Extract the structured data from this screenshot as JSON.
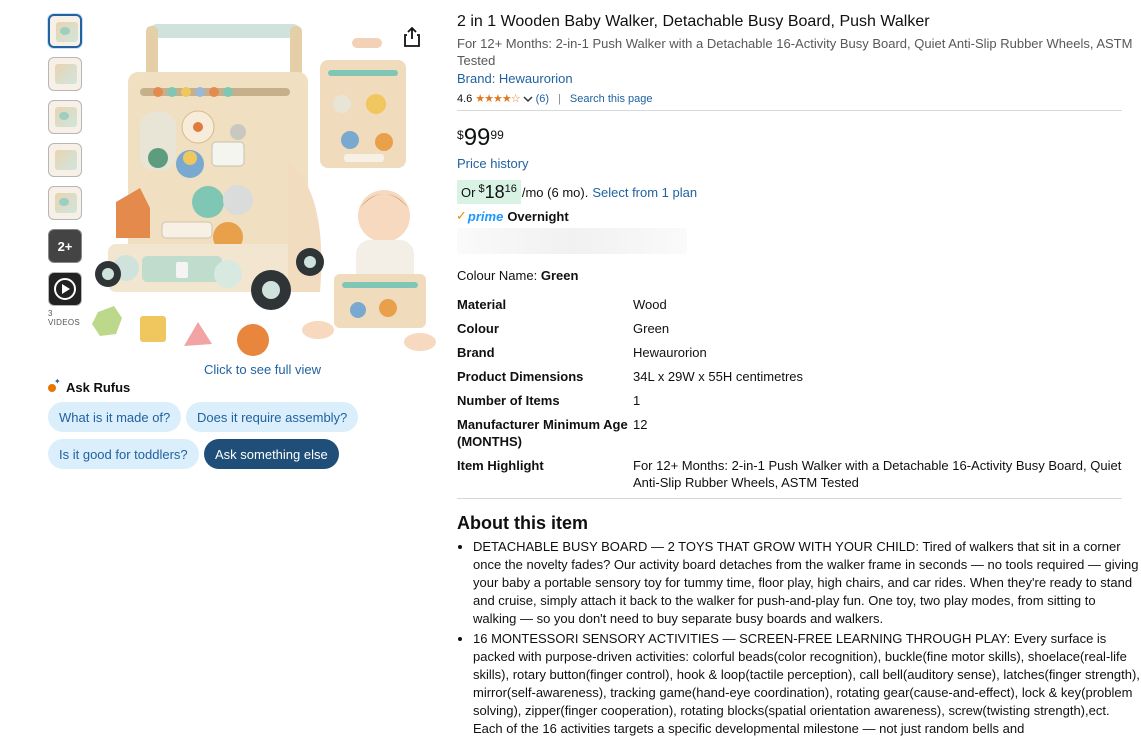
{
  "thumbnails": {
    "more_label": "2+",
    "videos_label": "3 VIDEOS"
  },
  "main_image": {
    "click_full_view": "Click to see full view"
  },
  "rufus": {
    "title": "Ask Rufus",
    "chips": [
      "What is it made of?",
      "Does it require assembly?",
      "Is it good for toddlers?",
      "Ask something else"
    ]
  },
  "product": {
    "title": "2 in 1 Wooden Baby Walker, Detachable Busy Board, Push Walker",
    "subtitle": "For 12+ Months: 2-in-1 Push Walker with a Detachable 16-Activity Busy Board, Quiet Anti-Slip Rubber Wheels, ASTM Tested",
    "brand_link": "Brand: Hewaurorion",
    "rating_value": "4.6",
    "rating_stars": "★★★★☆",
    "rating_count": "(6)",
    "rating_sep": "|",
    "search_page": "Search this page",
    "price_symbol": "$",
    "price_whole": "99",
    "price_fraction": "99",
    "price_history": "Price history",
    "plan_prefix": "Or",
    "plan_symbol": "$",
    "plan_whole": "18",
    "plan_fraction": "16",
    "plan_suffix": "/mo (6 mo).",
    "plan_link": "Select from 1 plan",
    "prime_check": "✓",
    "prime_word": "prime",
    "prime_delivery": "Overnight",
    "colour_label": "Colour Name:",
    "colour_value": "Green"
  },
  "specs": [
    {
      "k": "Material",
      "v": "Wood"
    },
    {
      "k": "Colour",
      "v": "Green"
    },
    {
      "k": "Brand",
      "v": "Hewaurorion"
    },
    {
      "k": "Product Dimensions",
      "v": "34L x 29W x 55H centimetres"
    },
    {
      "k": "Number of Items",
      "v": "1"
    },
    {
      "k": "Manufacturer Minimum Age (MONTHS)",
      "v": "12"
    },
    {
      "k": "Item Highlight",
      "v": "For 12+ Months: 2-in-1 Push Walker with a Detachable 16-Activity Busy Board, Quiet Anti-Slip Rubber Wheels, ASTM Tested"
    }
  ],
  "about": {
    "title": "About this item",
    "bullets": [
      "DETACHABLE BUSY BOARD — 2 TOYS THAT GROW WITH YOUR CHILD: Tired of walkers that sit in a corner once the novelty fades? Our activity board detaches from the walker frame in seconds — no tools required — giving your baby a portable sensory toy for tummy time, floor play, high chairs, and car rides. When they're ready to stand and cruise, simply attach it back to the walker for push-and-play fun. One toy, two play modes, from sitting to walking — so you don't need to buy separate busy boards and walkers.",
      "16 MONTESSORI SENSORY ACTIVITIES — SCREEN-FREE LEARNING THROUGH PLAY: Every surface is packed with purpose-driven activities: colorful beads(color recognition), buckle(fine motor skills), shoelace(real-life skills), rotary button(finger control), hook & loop(tactile perception), call bell(auditory sense), latches(finger strength), mirror(self-awareness), tracking game(hand-eye coordination), rotating gear(cause-and-effect), lock & key(problem solving), zipper(finger cooperation), rotating blocks(spatial orientation awareness), screw(twisting strength),ect. Each of the 16 activities targets a specific developmental milestone — not just random bells and"
    ]
  }
}
